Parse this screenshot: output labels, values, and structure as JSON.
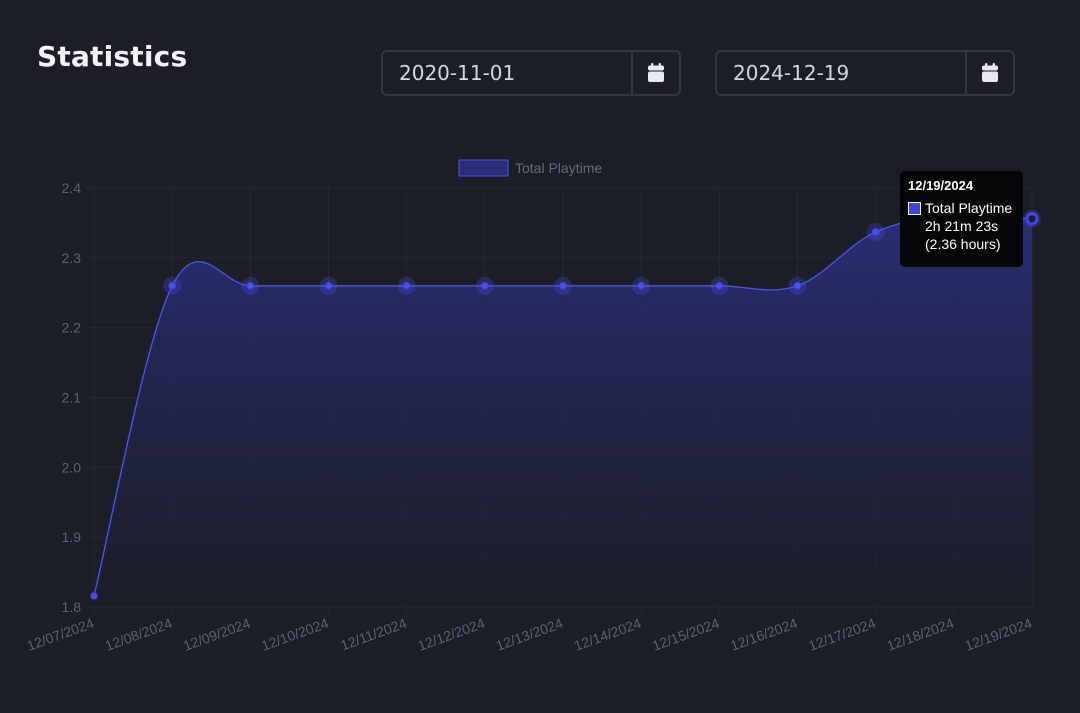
{
  "header": {
    "title": "Statistics"
  },
  "filters": {
    "start_date": "2020-11-01",
    "end_date": "2024-12-19",
    "calendar_icon": "calendar-icon"
  },
  "tooltip": {
    "date": "12/19/2024",
    "series": "Total Playtime",
    "duration": "2h 21m 23s",
    "hours": "(2.36 hours)"
  },
  "colors": {
    "background": "#1b1d27",
    "line": "#4a52e8",
    "area_top": "#2b2f7a",
    "grid": "#252835",
    "tick": "#5f6272"
  },
  "chart_data": {
    "type": "area",
    "title": "",
    "xlabel": "",
    "ylabel": "",
    "x": [
      "12/07/2024",
      "12/08/2024",
      "12/09/2024",
      "12/10/2024",
      "12/11/2024",
      "12/12/2024",
      "12/13/2024",
      "12/14/2024",
      "12/15/2024",
      "12/16/2024",
      "12/17/2024",
      "12/18/2024",
      "12/19/2024"
    ],
    "series": [
      {
        "name": "Total Playtime",
        "values": [
          1.816,
          2.26,
          2.26,
          2.26,
          2.26,
          2.26,
          2.26,
          2.26,
          2.26,
          2.26,
          2.337,
          2.36,
          2.356
        ]
      }
    ],
    "ylim": [
      1.8,
      2.4
    ],
    "yticks": [
      "1.8",
      "1.9",
      "2.0",
      "2.1",
      "2.2",
      "2.3",
      "2.4"
    ],
    "legend": "top-center",
    "grid": true
  }
}
